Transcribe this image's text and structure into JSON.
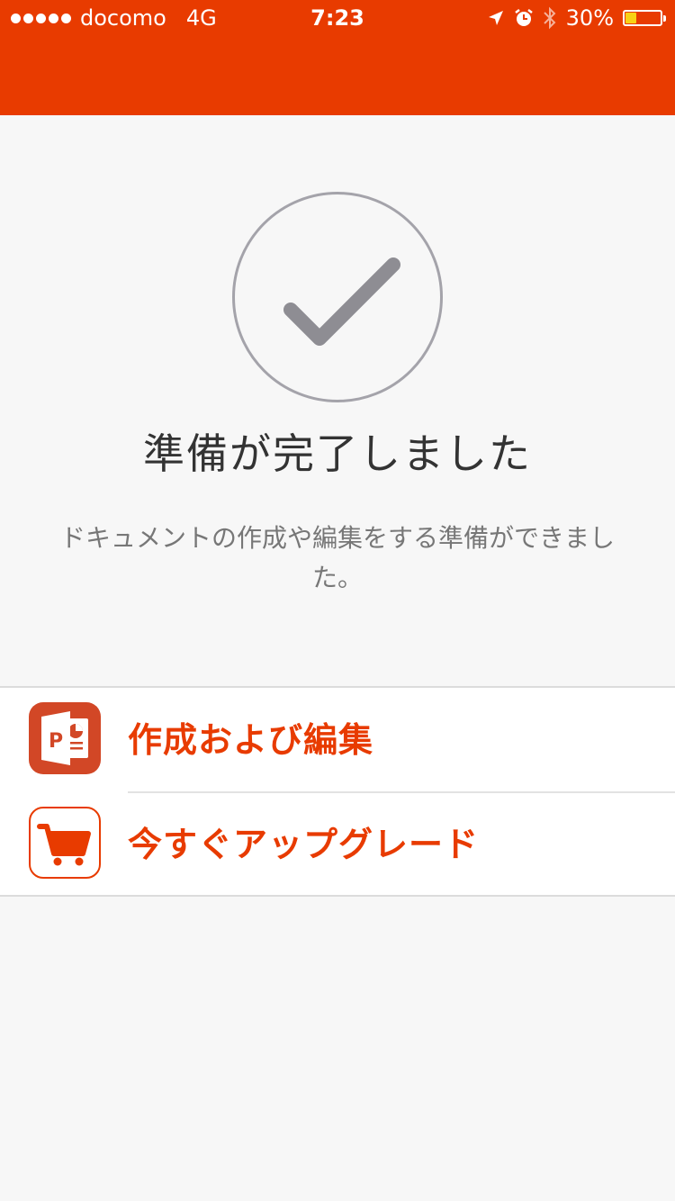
{
  "status_bar": {
    "carrier": "docomo",
    "network": "4G",
    "time": "7:23",
    "battery_percent": "30%",
    "battery_level": 0.3,
    "icons": [
      "location-arrow-icon",
      "alarm-icon",
      "bluetooth-icon",
      "battery-icon"
    ]
  },
  "theme": {
    "accent": "#e83b00",
    "powerpoint": "#d24726",
    "check_gray": "#8e8d93"
  },
  "hero": {
    "icon": "checkmark-icon",
    "title": "準備が完了しました",
    "subtitle": "ドキュメントの作成や編集をする準備ができました。"
  },
  "actions": [
    {
      "icon": "powerpoint-icon",
      "label": "作成および編集"
    },
    {
      "icon": "shopping-cart-icon",
      "label": "今すぐアップグレード"
    }
  ]
}
